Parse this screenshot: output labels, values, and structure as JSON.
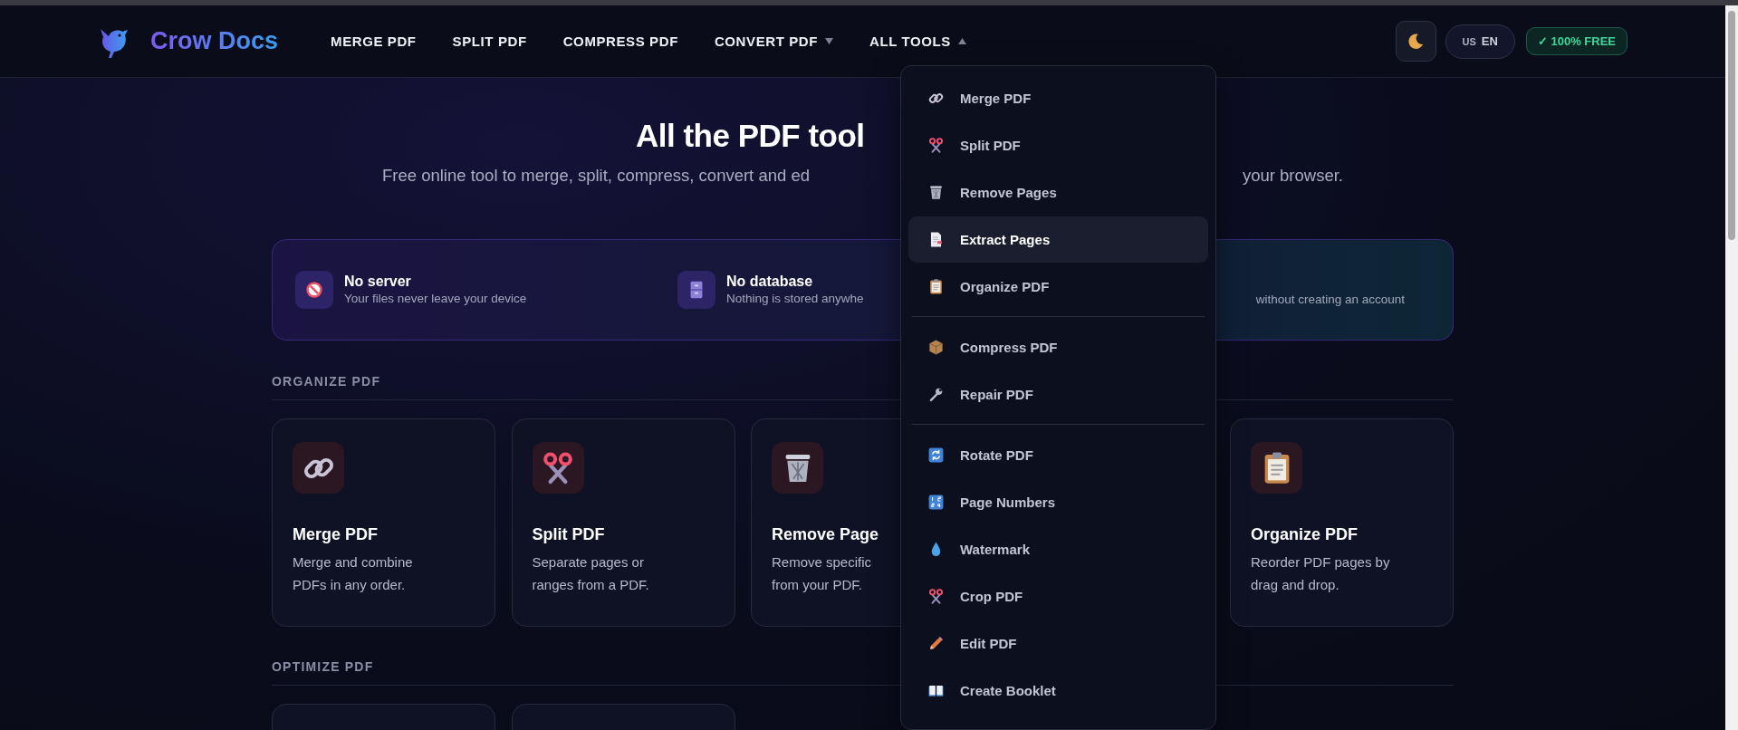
{
  "header": {
    "logo": "Crow Docs",
    "nav": [
      {
        "label": "MERGE PDF",
        "kind": "link"
      },
      {
        "label": "SPLIT PDF",
        "kind": "link"
      },
      {
        "label": "COMPRESS PDF",
        "kind": "link"
      },
      {
        "label": "CONVERT PDF",
        "kind": "dropdown",
        "expanded": false
      },
      {
        "label": "ALL TOOLS",
        "kind": "dropdown",
        "expanded": true
      }
    ],
    "language": {
      "country": "US",
      "code": "EN"
    },
    "badge": "✓ 100% FREE"
  },
  "hero": {
    "title": "All the PDF tool",
    "subtitle_left": "Free online tool to merge, split, compress, convert and ed",
    "subtitle_right": "your browser."
  },
  "features": [
    {
      "title": "No server",
      "description": "Your files never leave your device"
    },
    {
      "title": "No database",
      "description": "Nothing is stored anywhe"
    },
    {
      "description": "without creating an account"
    }
  ],
  "sections": [
    {
      "title": "ORGANIZE PDF",
      "cards": [
        {
          "kind": "tool",
          "title": "Merge PDF",
          "description": "Merge and combine\nPDFs in any order."
        },
        {
          "kind": "tool",
          "title": "Split PDF",
          "description": "Separate pages or\nranges from a PDF."
        },
        {
          "kind": "tool",
          "title": "Remove Page",
          "description": "Remove specific\nfrom your PDF."
        },
        {
          "kind": "tool",
          "title": "Organize PDF",
          "description": "Reorder PDF pages by\ndrag and drop."
        }
      ]
    },
    {
      "title": "OPTIMIZE PDF",
      "cards": [
        {
          "kind": "blank"
        },
        {
          "kind": "blank"
        }
      ]
    }
  ],
  "dropdown": {
    "groups": [
      [
        {
          "label": "Merge PDF",
          "selected": false
        },
        {
          "label": "Split PDF",
          "selected": false
        },
        {
          "label": "Remove Pages",
          "selected": false
        },
        {
          "label": "Extract Pages",
          "selected": true
        },
        {
          "label": "Organize PDF",
          "selected": false
        }
      ],
      [
        {
          "label": "Compress PDF",
          "selected": false
        },
        {
          "label": "Repair PDF",
          "selected": false
        }
      ],
      [
        {
          "label": "Rotate PDF",
          "selected": false
        },
        {
          "label": "Page Numbers",
          "selected": false
        },
        {
          "label": "Watermark",
          "selected": false
        },
        {
          "label": "Crop PDF",
          "selected": false
        },
        {
          "label": "Edit PDF",
          "selected": false
        },
        {
          "label": "Create Booklet",
          "selected": false
        }
      ]
    ]
  }
}
